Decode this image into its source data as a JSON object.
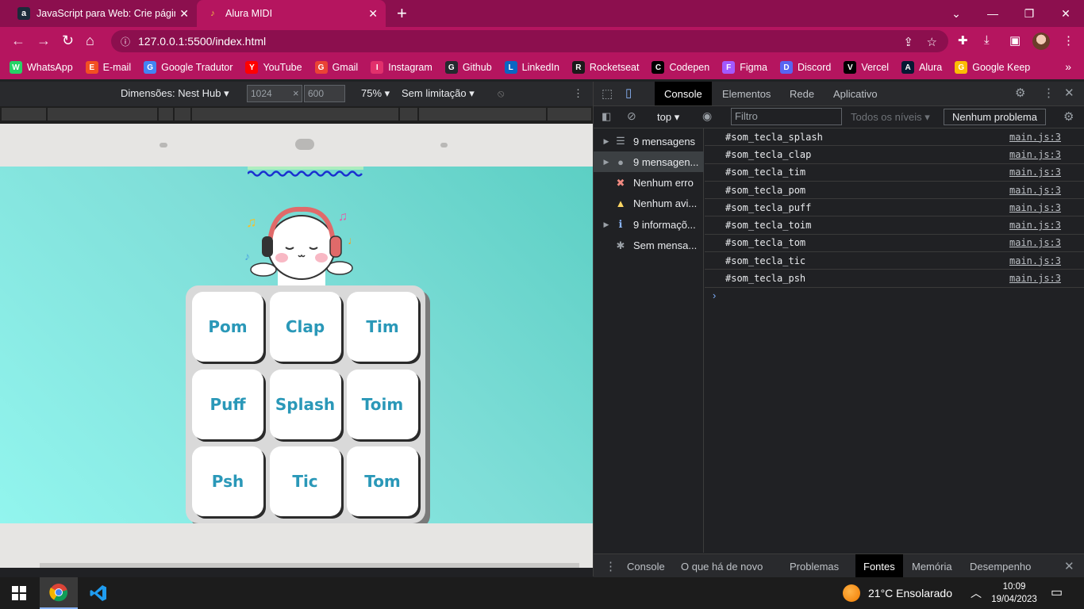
{
  "browser": {
    "tabs": [
      {
        "title": "JavaScript para Web: Crie páginas",
        "favicon": "a"
      },
      {
        "title": "Alura MIDI",
        "favicon": "♪"
      }
    ],
    "url": "127.0.0.1:5500/index.html",
    "accent": "#b5155f",
    "bookmarks": [
      {
        "label": "WhatsApp",
        "icon": "whatsapp-icon",
        "color": "#25d366"
      },
      {
        "label": "E-mail",
        "icon": "microsoft-icon",
        "color": "#f25022"
      },
      {
        "label": "Google Tradutor",
        "icon": "translate-icon",
        "color": "#4285f4"
      },
      {
        "label": "YouTube",
        "icon": "youtube-icon",
        "color": "#ff0000"
      },
      {
        "label": "Gmail",
        "icon": "gmail-icon",
        "color": "#ea4335"
      },
      {
        "label": "Instagram",
        "icon": "instagram-icon",
        "color": "#e1306c"
      },
      {
        "label": "Github",
        "icon": "github-icon",
        "color": "#24292e"
      },
      {
        "label": "LinkedIn",
        "icon": "linkedin-icon",
        "color": "#0a66c2"
      },
      {
        "label": "Rocketseat",
        "icon": "rocketseat-icon",
        "color": "#1a1a1a"
      },
      {
        "label": "Codepen",
        "icon": "codepen-icon",
        "color": "#000000"
      },
      {
        "label": "Figma",
        "icon": "figma-icon",
        "color": "#a259ff"
      },
      {
        "label": "Discord",
        "icon": "discord-icon",
        "color": "#5865f2"
      },
      {
        "label": "Vercel",
        "icon": "vercel-icon",
        "color": "#000000"
      },
      {
        "label": "Alura",
        "icon": "alura-icon",
        "color": "#051933"
      },
      {
        "label": "Google Keep",
        "icon": "keep-icon",
        "color": "#fbbc04"
      }
    ]
  },
  "device_toolbar": {
    "dimensions": "Dimensões: Nest Hub",
    "width": "1024",
    "height": "600",
    "zoom": "75%",
    "throttle": "Sem limitação"
  },
  "midi": {
    "keys": [
      "Pom",
      "Clap",
      "Tim",
      "Puff",
      "Splash",
      "Toim",
      "Psh",
      "Tic",
      "Tom"
    ]
  },
  "devtools": {
    "tabs": [
      "Console",
      "Elementos",
      "Rede",
      "Aplicativo"
    ],
    "context": "top",
    "filter_placeholder": "Filtro",
    "levels": "Todos os níveis",
    "issues": "Nenhum problema",
    "sidebar": [
      {
        "label": "9 mensagens",
        "icon": "list-icon"
      },
      {
        "label": "9 mensagen...",
        "icon": "user-icon"
      },
      {
        "label": "Nenhum erro",
        "icon": "error-icon"
      },
      {
        "label": "Nenhum avi...",
        "icon": "warning-icon"
      },
      {
        "label": "9 informaçõ...",
        "icon": "info-icon"
      },
      {
        "label": "Sem mensa...",
        "icon": "bug-icon"
      }
    ],
    "logs": [
      {
        "text": "#som_tecla_splash",
        "source": "main.js:3"
      },
      {
        "text": "#som_tecla_clap",
        "source": "main.js:3"
      },
      {
        "text": "#som_tecla_tim",
        "source": "main.js:3"
      },
      {
        "text": "#som_tecla_pom",
        "source": "main.js:3"
      },
      {
        "text": "#som_tecla_puff",
        "source": "main.js:3"
      },
      {
        "text": "#som_tecla_toim",
        "source": "main.js:3"
      },
      {
        "text": "#som_tecla_tom",
        "source": "main.js:3"
      },
      {
        "text": "#som_tecla_tic",
        "source": "main.js:3"
      },
      {
        "text": "#som_tecla_psh",
        "source": "main.js:3"
      }
    ],
    "drawer_tabs": [
      "Console",
      "O que há de novo",
      "Problemas",
      "Fontes",
      "Memória",
      "Desempenho"
    ]
  },
  "taskbar": {
    "weather": "21°C  Ensolarado",
    "time": "10:09",
    "date": "19/04/2023"
  }
}
